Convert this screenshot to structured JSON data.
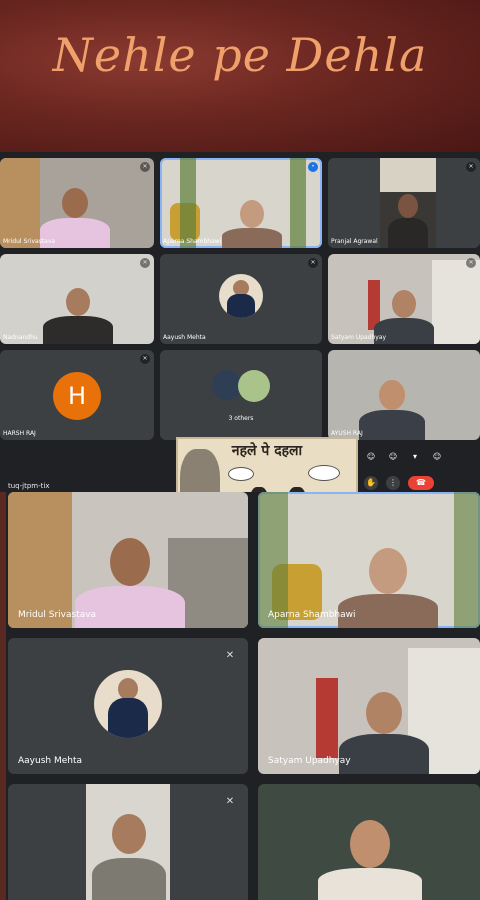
{
  "banner": {
    "title": "Nehle pe Dehla"
  },
  "meeting": {
    "code": "tuq-jtpm-tix"
  },
  "poster": {
    "title": "नहले पे दहला"
  },
  "top_grid": {
    "tiles": [
      {
        "name": "Mridul Srivastava"
      },
      {
        "name": "Aparna Shambhawi"
      },
      {
        "name": "Pranjal Agrawal"
      },
      {
        "name": "Nadnandhu"
      },
      {
        "name": "Aayush Mehta"
      },
      {
        "name": "Satyam Upadhyay"
      },
      {
        "name": "HARSH RAJ",
        "initial": "H"
      },
      {
        "name": "3 others"
      },
      {
        "name": "AYUSH RAJ"
      }
    ]
  },
  "bottom_grid": {
    "tiles": [
      {
        "name": "Mridul Srivastava"
      },
      {
        "name": "Aparna Shambhawi"
      },
      {
        "name": "Aayush Mehta"
      },
      {
        "name": "Satyam Upadhyay"
      },
      {
        "name": ""
      },
      {
        "name": ""
      }
    ]
  },
  "icons": {
    "mic_off": "mic-off-icon",
    "more": "more-vert-icon",
    "hangup": "call-end-icon",
    "raise_hand": "raise-hand-icon",
    "emoji": "emoji-icon"
  },
  "colors": {
    "accent_blue": "#8ab4f8",
    "hangup_red": "#ea4335",
    "avatar_orange": "#e8710a",
    "banner_text": "#f0a06a"
  }
}
